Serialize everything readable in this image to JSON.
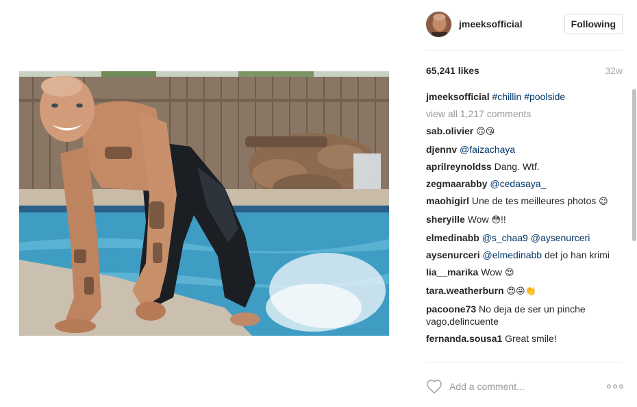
{
  "post": {
    "username": "jmeeksofficial",
    "follow_label": "Following",
    "likes": "65,241 likes",
    "time_ago": "32w"
  },
  "caption": {
    "user": "jmeeksofficial",
    "tags": [
      "#chillin",
      "#poolside"
    ]
  },
  "view_all": "view all 1,217 comments",
  "comments": [
    {
      "user": "sab.olivier",
      "parts": [
        {
          "t": "emoji",
          "v": "🙃😘"
        }
      ]
    },
    {
      "user": "djennv",
      "parts": [
        {
          "t": "mention",
          "v": "@faizachaya"
        }
      ]
    },
    {
      "user": "aprilreynoldss",
      "parts": [
        {
          "t": "text",
          "v": "Dang. Wtf."
        }
      ]
    },
    {
      "user": "zegmaarabby",
      "parts": [
        {
          "t": "mention",
          "v": "@cedasaya_"
        }
      ]
    },
    {
      "user": "maohigirl",
      "parts": [
        {
          "t": "text",
          "v": "Une de tes meilleures photos "
        },
        {
          "t": "emoji",
          "v": "😉"
        }
      ]
    },
    {
      "user": "sheryille",
      "parts": [
        {
          "t": "text",
          "v": "Wow "
        },
        {
          "t": "emoji",
          "v": "😳"
        },
        {
          "t": "text",
          "v": "!!"
        }
      ]
    },
    {
      "user": "elmedinabb",
      "parts": [
        {
          "t": "mention",
          "v": "@s_chaa9"
        },
        {
          "t": "text",
          "v": " "
        },
        {
          "t": "mention",
          "v": "@aysenurceri"
        }
      ]
    },
    {
      "user": "aysenurceri",
      "parts": [
        {
          "t": "mention",
          "v": "@elmedinabb"
        },
        {
          "t": "text",
          "v": " det jo han krimi"
        }
      ]
    },
    {
      "user": "lia__marika",
      "parts": [
        {
          "t": "text",
          "v": "Wow "
        },
        {
          "t": "emoji",
          "v": "😍"
        }
      ]
    },
    {
      "user": "tara.weatherburn",
      "parts": [
        {
          "t": "emoji",
          "v": "😍😜👏"
        }
      ]
    },
    {
      "user": "pacoone73",
      "parts": [
        {
          "t": "text",
          "v": "No deja de ser un pinche vago,delincuente"
        }
      ]
    },
    {
      "user": "fernanda.sousa1",
      "parts": [
        {
          "t": "text",
          "v": "Great smile!"
        }
      ]
    }
  ],
  "add_comment": {
    "placeholder": "Add a comment..."
  },
  "icons": {
    "like": "heart-icon",
    "more": "more-options-icon"
  },
  "colors": {
    "link": "#003569",
    "muted": "#999999",
    "border": "#dbdbdb"
  }
}
